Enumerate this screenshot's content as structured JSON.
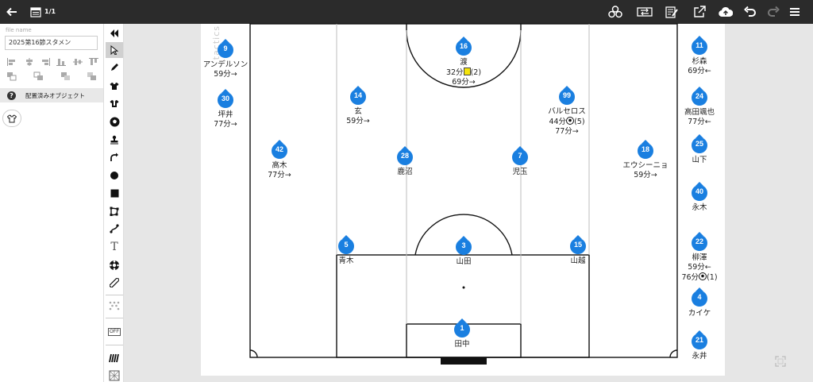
{
  "topbar": {
    "page_count": "1/1",
    "icons": [
      "back-arrow-icon",
      "pages-icon",
      "shapes-icon",
      "swap-icon",
      "edit-memo-icon",
      "share-icon",
      "cloud-upload-icon",
      "undo-icon",
      "redo-icon",
      "menu-icon"
    ]
  },
  "left_panel": {
    "file_name_label": "file name",
    "file_name_value": "2025第16節スタメン",
    "placed_objects_title": "配置済みオブジェクト",
    "help_icon": "?"
  },
  "tools": [
    "collapse-icon",
    "pointer-icon",
    "pen-icon",
    "shirt-icon",
    "shirt-alt-icon",
    "ball-icon",
    "stamp-icon",
    "curved-arrow-icon",
    "circle-icon",
    "square-icon",
    "polygon-icon",
    "line-icon",
    "text-icon",
    "team-ball-icon",
    "ruler-icon",
    "formation-icon",
    "off-toggle-icon",
    "grass-icon",
    "pattern-icon"
  ],
  "tool_text": {
    "text_tool": "T",
    "off": "OFF"
  },
  "canvas": {
    "watermark": "tactics"
  },
  "colors": {
    "pin": "#1a7fe0",
    "topbar": "#2b2b2b",
    "yellow_card": "#f4e40b"
  },
  "players_on_pitch": [
    {
      "num": "16",
      "name": "渡",
      "lines": [
        "32分",
        "(2)",
        "69分→"
      ]
    },
    {
      "num": "14",
      "name": "玄",
      "lines": [
        "59分→"
      ]
    },
    {
      "num": "99",
      "name": "バルセロス",
      "lines": [
        "44分",
        "(5)",
        "77分→"
      ]
    },
    {
      "num": "42",
      "name": "高木",
      "lines": [
        "77分→"
      ]
    },
    {
      "num": "28",
      "name": "鹿沼",
      "lines": []
    },
    {
      "num": "7",
      "name": "児玉",
      "lines": []
    },
    {
      "num": "18",
      "name": "エウシーニョ",
      "lines": [
        "59分→"
      ]
    },
    {
      "num": "5",
      "name": "青木",
      "lines": []
    },
    {
      "num": "3",
      "name": "山田",
      "lines": []
    },
    {
      "num": "15",
      "name": "山越",
      "lines": []
    },
    {
      "num": "1",
      "name": "田中",
      "lines": []
    }
  ],
  "bench_left": [
    {
      "num": "9",
      "name": "アンデルソン",
      "lines": [
        "59分→"
      ]
    },
    {
      "num": "30",
      "name": "坪井",
      "lines": [
        "77分→"
      ]
    }
  ],
  "bench_right": [
    {
      "num": "11",
      "name": "杉森",
      "lines": [
        "69分←"
      ]
    },
    {
      "num": "24",
      "name": "高田颯也",
      "lines": [
        "77分←"
      ]
    },
    {
      "num": "25",
      "name": "山下",
      "lines": []
    },
    {
      "num": "40",
      "name": "永木",
      "lines": []
    },
    {
      "num": "22",
      "name": "柳澤",
      "lines": [
        "59分←",
        "76分",
        "(1)"
      ]
    },
    {
      "num": "4",
      "name": "カイケ",
      "lines": []
    },
    {
      "num": "21",
      "name": "永井",
      "lines": []
    }
  ]
}
